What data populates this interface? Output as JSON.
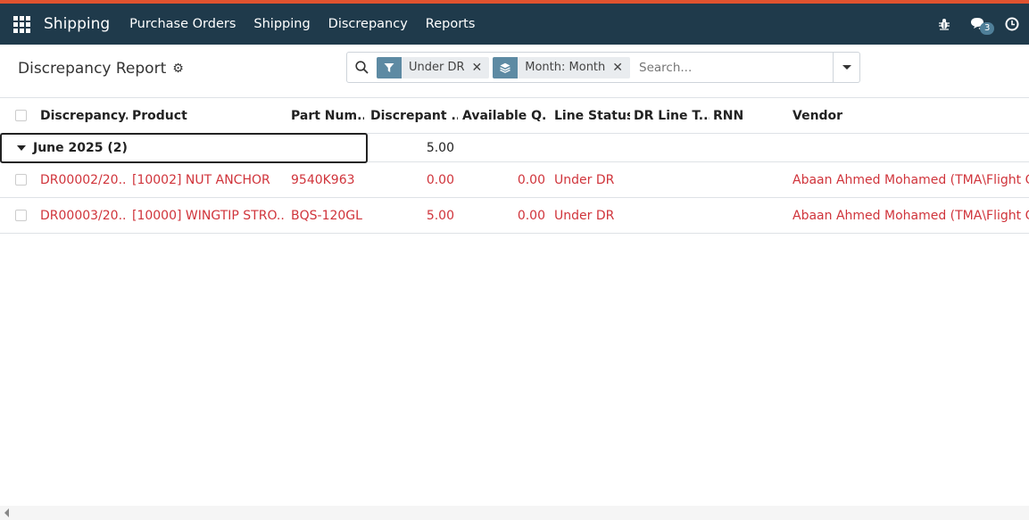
{
  "app": {
    "brand": "Shipping",
    "menu": [
      "Purchase Orders",
      "Shipping",
      "Discrepancy",
      "Reports"
    ],
    "messages_count": "3",
    "accent_color": "#1f3a4b"
  },
  "control_panel": {
    "title": "Discrepancy Report",
    "facets": [
      {
        "icon": "filter-icon",
        "label": "Under DR"
      },
      {
        "icon": "layers-icon",
        "label": "Month: Month"
      }
    ],
    "search_placeholder": "Search..."
  },
  "table": {
    "columns": [
      "Discrepancy...",
      "Product",
      "Part Num...",
      "Discrepant ...",
      "Available Q...",
      "Line Status",
      "DR Line T...",
      "RNN",
      "Vendor"
    ],
    "group": {
      "label": "June 2025 (2)",
      "discrepant_total": "5.00"
    },
    "rows": [
      {
        "ref": "DR00002/20...",
        "product": "[10002] NUT ANCHOR",
        "part": "9540K963",
        "discrepant": "0.00",
        "available": "0.00",
        "status": "Under DR",
        "dr_line_type": "",
        "rnn": "",
        "vendor": "Abaan Ahmed Mohamed (TMA\\Flight Ope"
      },
      {
        "ref": "DR00003/20...",
        "product": "[10000] WINGTIP STRO...",
        "part": "BQS-120GL",
        "discrepant": "5.00",
        "available": "0.00",
        "status": "Under DR",
        "dr_line_type": "",
        "rnn": "",
        "vendor": "Abaan Ahmed Mohamed (TMA\\Flight Ope"
      }
    ],
    "row_text_color": "#d0343b"
  }
}
